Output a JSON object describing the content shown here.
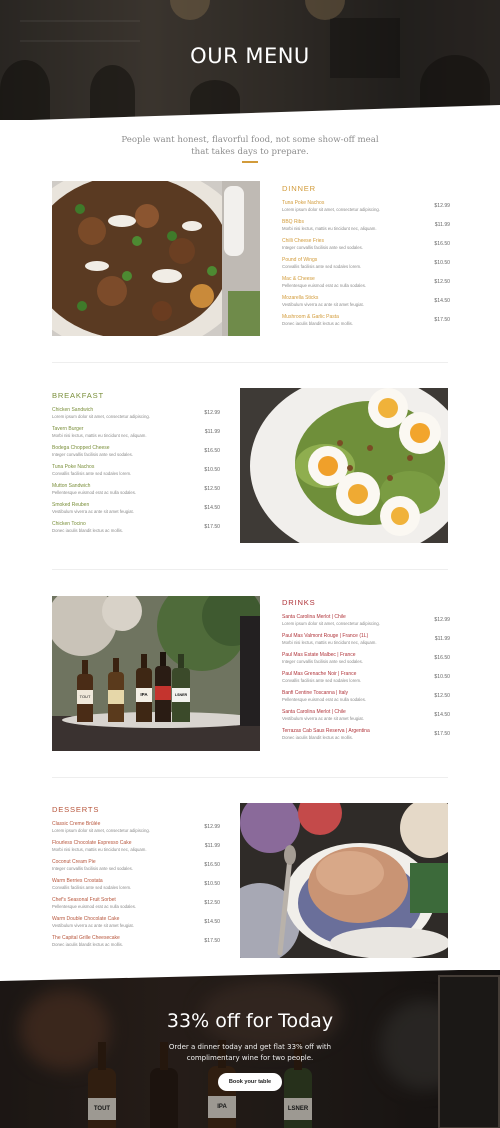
{
  "hero": {
    "title": "OUR MENU"
  },
  "intro": {
    "text": "People want honest, flavorful food, not some show-off meal that takes days to prepare."
  },
  "colors": {
    "accent": "#d29b3a",
    "breakfast": "#7a8f3a",
    "drinks": "#b0343a",
    "desserts": "#b7553b",
    "dinner": "#d29b3a"
  },
  "sections": {
    "dinner": {
      "title": "DINNER",
      "items": [
        {
          "name": "Tuna Poke Nachos",
          "desc": "Lorem ipsum dolor sit amet, consectetur adipiscing.",
          "price": "$12.99"
        },
        {
          "name": "BBQ Ribs",
          "desc": "Morbi nisi lectus, mattis eu tincidunt nec, aliquam.",
          "price": "$11.99"
        },
        {
          "name": "Chilli Cheese Fries",
          "desc": "Integer convallis facilisis ante sed sodales.",
          "price": "$16.50"
        },
        {
          "name": "Pound of Wings",
          "desc": "Convallis facilisis ante sed sodales lorem.",
          "price": "$10.50"
        },
        {
          "name": "Mac & Cheese",
          "desc": "Pellentesque euismod erat ac nulla sodales.",
          "price": "$12.50"
        },
        {
          "name": "Mozarella Sticks",
          "desc": "Vestibulum viverra ac ante sit amet feugiat.",
          "price": "$14.50"
        },
        {
          "name": "Mushroom & Garlic Pasta",
          "desc": "Donec iaculis blandit lectus ac mollis.",
          "price": "$17.50"
        }
      ]
    },
    "breakfast": {
      "title": "BREAKFAST",
      "items": [
        {
          "name": "Chicken Sandwich",
          "desc": "Lorem ipsum dolor sit amet, consectetur adipiscing.",
          "price": "$12.99"
        },
        {
          "name": "Tavern Burger",
          "desc": "Morbi nisi lectus, mattis eu tincidunt nec, aliquam.",
          "price": "$11.99"
        },
        {
          "name": "Bodega Chopped Cheese",
          "desc": "Integer convallis facilisis ante sed sodales.",
          "price": "$16.50"
        },
        {
          "name": "Tuna Poke Nachos",
          "desc": "Convallis facilisis ante sed sodales lorem.",
          "price": "$10.50"
        },
        {
          "name": "Mutton Sandwich",
          "desc": "Pellentesque euismod erat ac nulla sodales.",
          "price": "$12.50"
        },
        {
          "name": "Smoked Reuben",
          "desc": "Vestibulum viverra ac ante sit amet feugiat.",
          "price": "$14.50"
        },
        {
          "name": "Chicken Tocino",
          "desc": "Donec iaculis blandit lectus ac mollis.",
          "price": "$17.50"
        }
      ]
    },
    "drinks": {
      "title": "DRINKS",
      "items": [
        {
          "name": "Santa Carolina Merlot | Chile",
          "desc": "Lorem ipsum dolor sit amet, consectetur adipiscing.",
          "price": "$12.99"
        },
        {
          "name": "Paul Mas Valmont Rouge | France (1L)",
          "desc": "Morbi nisi lectus, mattis eu tincidunt nec, aliquam.",
          "price": "$11.99"
        },
        {
          "name": "Paul Mas Estate Malbec | France",
          "desc": "Integer convallis facilisis ante sed sodales.",
          "price": "$16.50"
        },
        {
          "name": "Paul Mas Grenache Noir | France",
          "desc": "Convallis facilisis ante sed sodales lorem.",
          "price": "$10.50"
        },
        {
          "name": "Banfi Centine Toscanna | Italy",
          "desc": "Pellentesque euismod erat ac nulla sodales.",
          "price": "$12.50"
        },
        {
          "name": "Santa Carolina Merlot | Chile",
          "desc": "Vestibulum viverra ac ante sit amet feugiat.",
          "price": "$14.50"
        },
        {
          "name": "Terrazas Cab Saus Reserva | Argentina",
          "desc": "Donec iaculis blandit lectus ac mollis.",
          "price": "$17.50"
        }
      ]
    },
    "desserts": {
      "title": "DESSERTS",
      "items": [
        {
          "name": "Classic Creme Brûlée",
          "desc": "Lorem ipsum dolor sit amet, consectetur adipiscing.",
          "price": "$12.99"
        },
        {
          "name": "Flourless Chocolate Espresso Cake",
          "desc": "Morbi nisi lectus, mattis eu tincidunt nec, aliquam.",
          "price": "$11.99"
        },
        {
          "name": "Coconut Cream Pie",
          "desc": "Integer convallis facilisis ante sed sodales.",
          "price": "$16.50"
        },
        {
          "name": "Warm Berries Crostata",
          "desc": "Convallis facilisis ante sed sodales lorem.",
          "price": "$10.50"
        },
        {
          "name": "Chef's Seasonal Fruit Sorbet",
          "desc": "Pellentesque euismod erat ac nulla sodales.",
          "price": "$12.50"
        },
        {
          "name": "Warm Double Chocolate Cake",
          "desc": "Vestibulum viverra ac ante sit amet feugiat.",
          "price": "$14.50"
        },
        {
          "name": "The Capital Grille Cheesecake",
          "desc": "Donec iaculis blandit lectus ac mollis.",
          "price": "$17.50"
        }
      ]
    }
  },
  "promo": {
    "title": "33% off for Today",
    "subtitle": "Order a dinner today and get flat 33% off with complimentary wine for two people.",
    "button": "Book your table",
    "bottle_labels": [
      "TOUT",
      "IPA",
      "LSNER"
    ]
  }
}
